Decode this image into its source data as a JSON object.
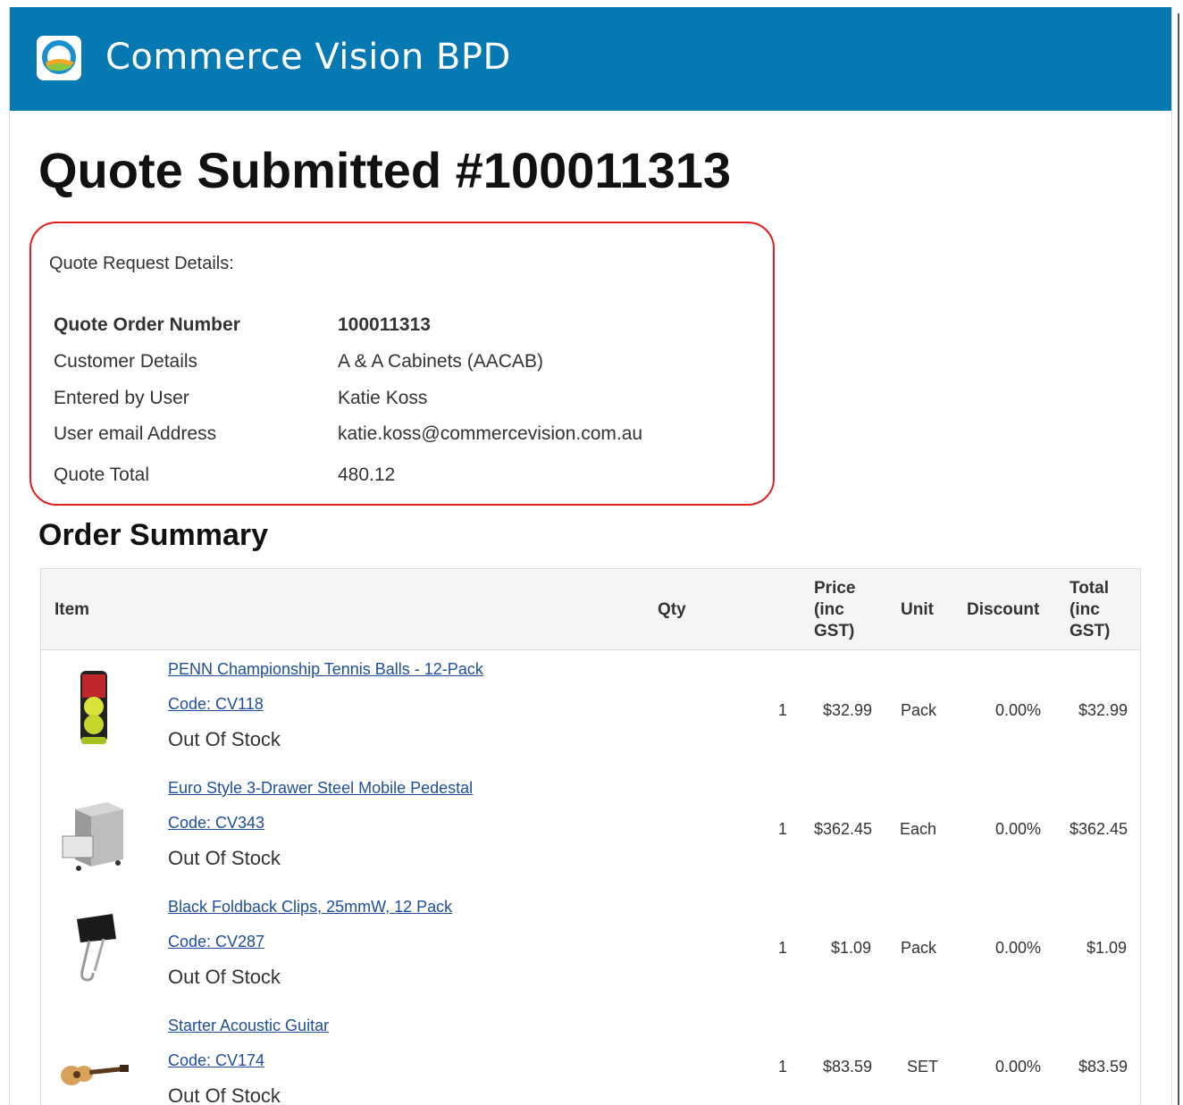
{
  "header": {
    "brand": "Commerce Vision BPD"
  },
  "page_title": "Quote Submitted #100011313",
  "quote_details": {
    "heading": "Quote Request Details:",
    "rows": [
      {
        "label": "Quote Order Number",
        "value": "100011313"
      },
      {
        "label": "Customer Details",
        "value": "A & A Cabinets (AACAB)"
      },
      {
        "label": "Entered by User",
        "value": "Katie Koss"
      },
      {
        "label": "User email Address",
        "value": "katie.koss@commercevision.com.au"
      },
      {
        "label": "Quote Total",
        "value": "480.12"
      }
    ]
  },
  "order_summary": {
    "title": "Order Summary",
    "columns": {
      "item": "Item",
      "qty": "Qty",
      "price": [
        "Price",
        "(inc",
        "GST)"
      ],
      "unit": "Unit",
      "discount": "Discount",
      "total": [
        "Total",
        "(inc",
        "GST)"
      ]
    },
    "items": [
      {
        "name": "PENN Championship Tennis Balls - 12-Pack",
        "code": "Code: CV118",
        "stock": "Out Of Stock",
        "qty": "1",
        "price": "$32.99",
        "unit": "Pack",
        "discount": "0.00%",
        "total": "$32.99",
        "thumb_icon": "tennis-balls-can-icon"
      },
      {
        "name": "Euro Style 3-Drawer Steel Mobile Pedestal",
        "code": "Code: CV343",
        "stock": "Out Of Stock",
        "qty": "1",
        "price": "$362.45",
        "unit": "Each",
        "discount": "0.00%",
        "total": "$362.45",
        "thumb_icon": "drawer-pedestal-icon"
      },
      {
        "name": "Black Foldback Clips, 25mmW, 12 Pack",
        "code": "Code: CV287",
        "stock": "Out Of Stock",
        "qty": "1",
        "price": "$1.09",
        "unit": "Pack",
        "discount": "0.00%",
        "total": "$1.09",
        "thumb_icon": "foldback-clip-icon"
      },
      {
        "name": "Starter Acoustic Guitar",
        "code": "Code: CV174",
        "stock": "Out Of Stock",
        "qty": "1",
        "price": "$83.59",
        "unit": "SET",
        "discount": "0.00%",
        "total": "$83.59",
        "thumb_icon": "guitar-icon"
      }
    ]
  },
  "colors": {
    "header_bg": "#0679b3",
    "highlight_border": "#e02020",
    "link": "#1f4e9a"
  }
}
